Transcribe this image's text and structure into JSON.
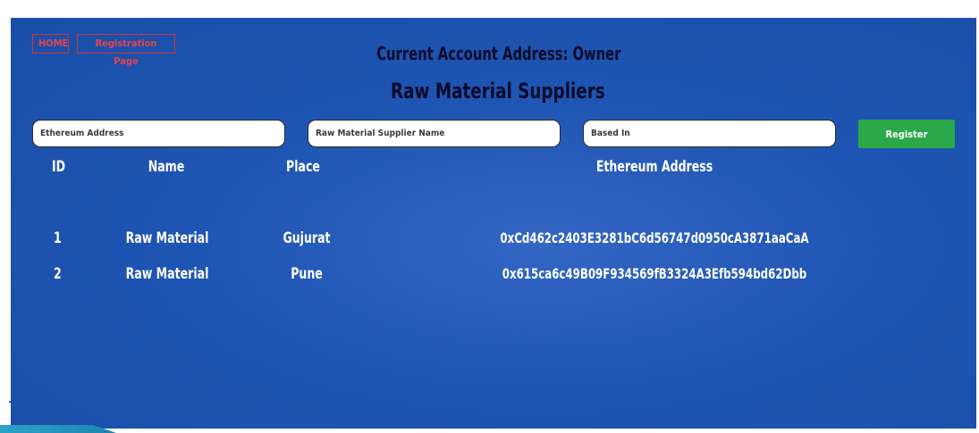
{
  "nav": {
    "home_label": "HOME",
    "registration_label": "Registration Page"
  },
  "account": {
    "text": "Current Account Address: Owner"
  },
  "page": {
    "title": "Raw Material Suppliers"
  },
  "form": {
    "address_placeholder": "Ethereum Address",
    "name_placeholder": "Raw Material Supplier Name",
    "based_placeholder": "Based In",
    "register_label": "Register"
  },
  "table": {
    "headers": {
      "id": "ID",
      "name": "Name",
      "place": "Place",
      "address": "Ethereum Address"
    },
    "rows": [
      {
        "id": "1",
        "name": "Raw Material",
        "place": "Gujurat",
        "address": "0xCd462c2403E3281bC6d56747d0950cA3871aaCaA"
      },
      {
        "id": "2",
        "name": "Raw Material",
        "place": "Pune",
        "address": "0x615ca6c49B09F934569fB3324A3Efb594bd62Dbb"
      }
    ]
  },
  "colors": {
    "background": "#1f55b3",
    "register_button": "#2aa84a",
    "nav_border": "#c9373a",
    "heading_text": "#0b0b2a"
  }
}
